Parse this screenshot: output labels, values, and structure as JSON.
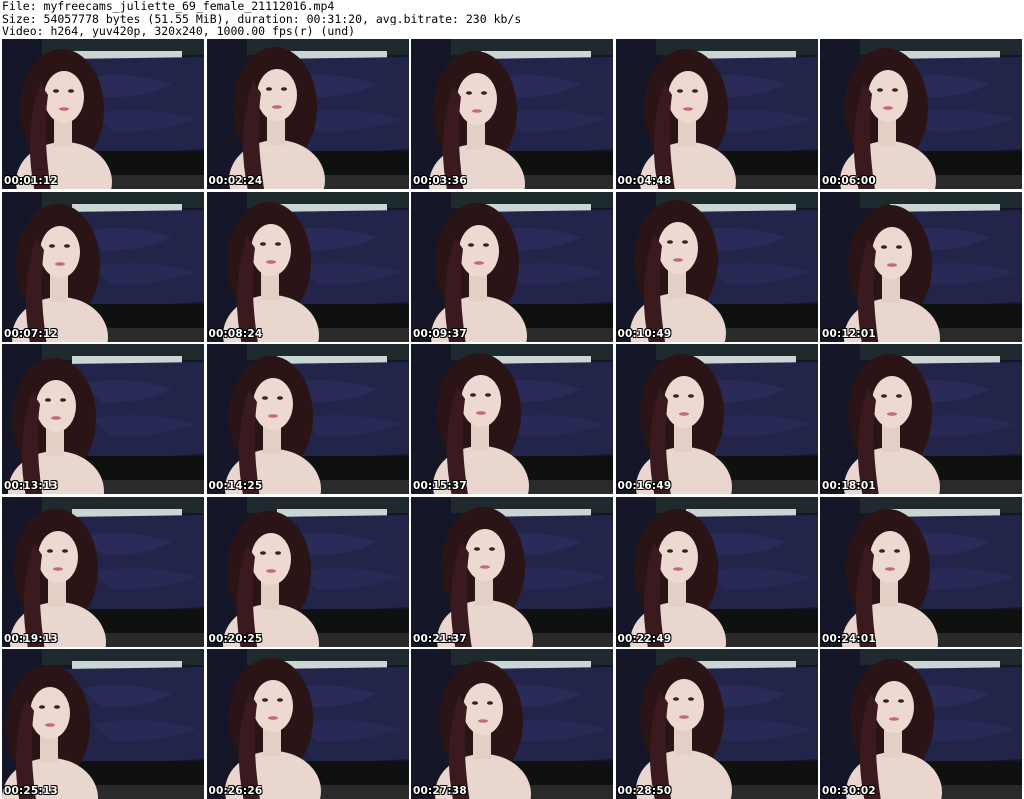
{
  "header": {
    "file_line": "File: myfreecams_juliette_69_female_21112016.mp4",
    "size_line": "Size: 54057778 bytes (51.55 MiB), duration: 00:31:20, avg.bitrate: 230 kb/s",
    "video_line": "Video: h264, yuv420p, 320x240, 1000.00 fps(r) (und)"
  },
  "thumbnails": [
    {
      "timestamp": "00:01:12"
    },
    {
      "timestamp": "00:02:24"
    },
    {
      "timestamp": "00:03:36"
    },
    {
      "timestamp": "00:04:48"
    },
    {
      "timestamp": "00:06:00"
    },
    {
      "timestamp": "00:07:12"
    },
    {
      "timestamp": "00:08:24"
    },
    {
      "timestamp": "00:09:37"
    },
    {
      "timestamp": "00:10:49"
    },
    {
      "timestamp": "00:12:01"
    },
    {
      "timestamp": "00:13:13"
    },
    {
      "timestamp": "00:14:25"
    },
    {
      "timestamp": "00:15:37"
    },
    {
      "timestamp": "00:16:49"
    },
    {
      "timestamp": "00:18:01"
    },
    {
      "timestamp": "00:19:13"
    },
    {
      "timestamp": "00:20:25"
    },
    {
      "timestamp": "00:21:37"
    },
    {
      "timestamp": "00:22:49"
    },
    {
      "timestamp": "00:24:01"
    },
    {
      "timestamp": "00:25:13"
    },
    {
      "timestamp": "00:26:26"
    },
    {
      "timestamp": "00:27:38"
    },
    {
      "timestamp": "00:28:50"
    },
    {
      "timestamp": "00:30:02"
    }
  ],
  "colors": {
    "bedspread": "#23244a",
    "wall": "#c9d6d3",
    "skin": "#e9d6cf",
    "hair": "#2a1416"
  }
}
